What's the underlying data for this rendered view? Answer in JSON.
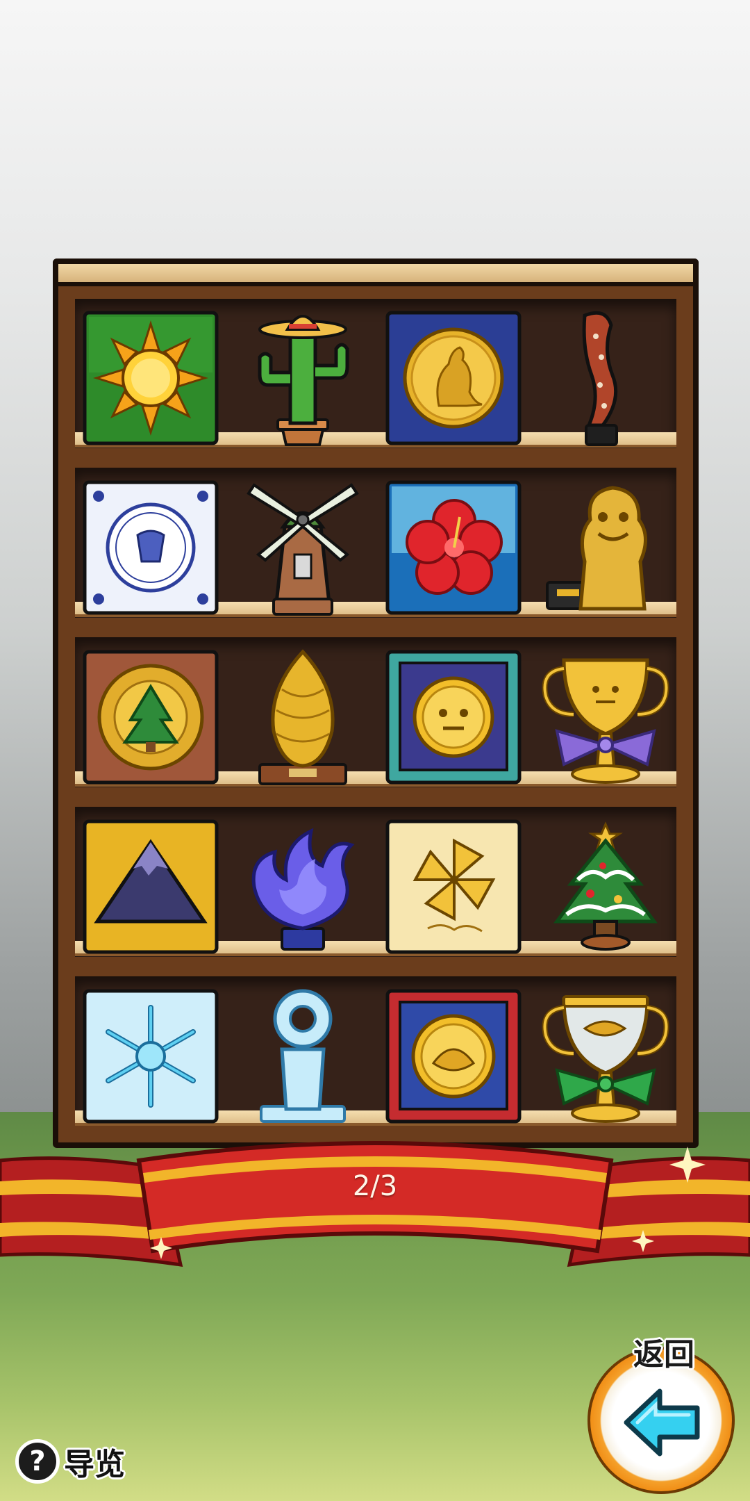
{
  "shelf": {
    "rows": [
      {
        "items": [
          "sun-plaque",
          "cactus-trophy",
          "kangaroo-medal-plaque",
          "boomerang-trophy"
        ]
      },
      {
        "items": [
          "delft-tile-plaque",
          "windmill-trophy",
          "hibiscus-plaque",
          "shisa-lion-trophy"
        ]
      },
      {
        "items": [
          "giant-sequoia-medal-plaque",
          "pinecone-trophy",
          "smiley-medal-frame",
          "gold-cup-blue-ribbon"
        ]
      },
      {
        "items": [
          "mountain-plaque",
          "blue-flame-trophy",
          "pinwheel-christmas-plaque",
          "christmas-tree-trophy"
        ]
      },
      {
        "items": [
          "snowflake-plaque",
          "glass-ring-trophy",
          "face-medal-red-frame",
          "glass-cup-green-ribbon"
        ]
      }
    ]
  },
  "pagination": {
    "current": "2/3"
  },
  "back_button": {
    "label": "返回"
  },
  "guide_button": {
    "icon": "?",
    "label": "导览"
  },
  "colors": {
    "shelf_wood": "#6b3d1c",
    "shelf_interior": "#362219",
    "ribbon_red": "#d02a26",
    "ribbon_gold": "#f2b52a",
    "back_orange": "#f08c14",
    "arrow_cyan": "#35d0f0"
  }
}
